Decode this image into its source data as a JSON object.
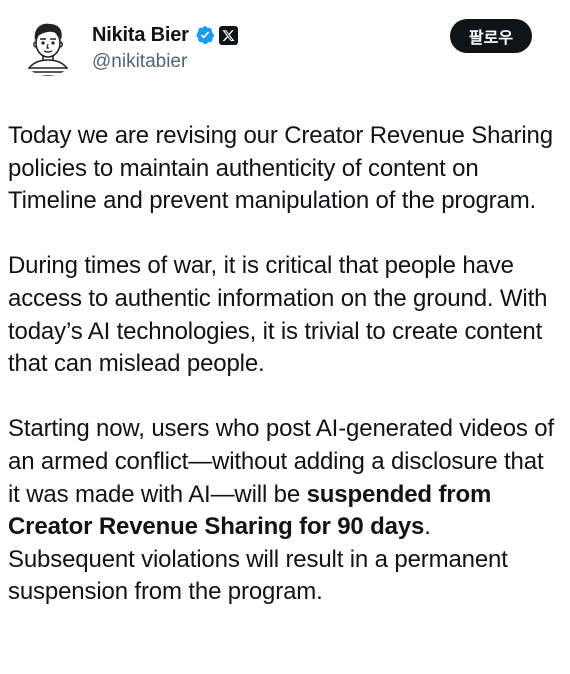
{
  "author": {
    "display_name": "Nikita Bier",
    "handle": "@nikitabier",
    "avatar_icon": "cartoon-avatar",
    "verified_icon": "verified-badge-icon",
    "verified_color": "#1d9bf0",
    "affiliation_icon": "x-logo-icon"
  },
  "follow_button": {
    "label": "팔로우",
    "background": "#0f1419",
    "text_color": "#ffffff"
  },
  "tweet": {
    "paragraph_1": "Today we are revising our Creator Revenue Sharing policies to maintain authenticity of content on Timeline and prevent manipulation of the program.",
    "paragraph_2": "During times of war, it is critical that people have access to authentic information on the ground. With today’s AI technologies, it is trivial to create content that can mislead people.",
    "paragraph_3_start": "Starting now, users who post AI-generated videos of an armed conflict—without adding a disclosure that it was made with AI—will be ",
    "paragraph_3_bold": "suspended from Creator Revenue Sharing for 90 days",
    "paragraph_3_end": ". Subsequent violations will result in a permanent suspension from the program."
  }
}
